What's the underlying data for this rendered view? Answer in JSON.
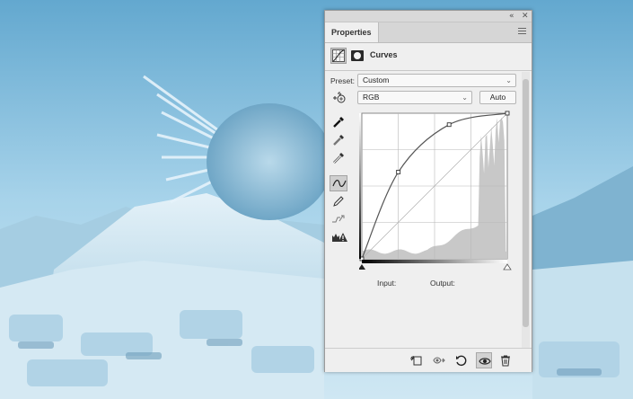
{
  "panel": {
    "tab_label": "Properties",
    "collapse_glyph": "«",
    "close_glyph": "✕",
    "adjustment_title": "Curves"
  },
  "controls": {
    "preset_label": "Preset:",
    "preset_value": "Custom",
    "channel_value": "RGB",
    "auto_label": "Auto",
    "input_label": "Input:",
    "output_label": "Output:"
  },
  "tools": [
    "on-image-adjust-icon",
    "black-point-eyedropper-icon",
    "gray-point-eyedropper-icon",
    "white-point-eyedropper-icon",
    "curve-point-icon",
    "pencil-icon",
    "smooth-curve-icon",
    "clipping-warning-icon"
  ],
  "curve": {
    "points": [
      [
        0,
        0
      ],
      [
        64,
        152
      ],
      [
        153,
        235
      ],
      [
        255,
        255
      ]
    ],
    "histogram_color": "#c8c8c8",
    "curve_color": "#555555"
  },
  "footer_icons": [
    "clip-to-layer-icon",
    "view-previous-icon",
    "reset-icon",
    "visibility-eye-icon",
    "trash-icon"
  ]
}
